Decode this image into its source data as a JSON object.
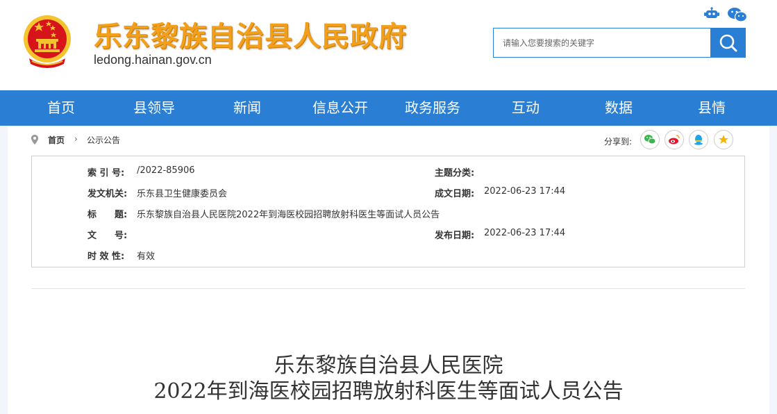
{
  "header": {
    "site_title": "乐东黎族自治县人民政府",
    "site_domain": "ledong.hainan.gov.cn",
    "robot_icon": "robot-icon",
    "wechat_icon": "wechat-icon",
    "search_placeholder": "请输入您要搜索的关键字",
    "search_icon": "search-icon"
  },
  "nav": {
    "items": [
      "首页",
      "县领导",
      "新闻",
      "信息公开",
      "政务服务",
      "互动",
      "数据",
      "县情"
    ]
  },
  "breadcrumb": {
    "home": "首页",
    "separator": "›",
    "current": "公示公告"
  },
  "share": {
    "label": "分享到:",
    "targets": [
      "wechat",
      "weibo",
      "qq",
      "favorite"
    ]
  },
  "meta": {
    "index_label": "索 引 号:",
    "index_value": "/2022-85906",
    "topic_label": "主题分类:",
    "topic_value": "",
    "issuer_label": "发文机关:",
    "issuer_value": "乐东县卫生健康委员会",
    "created_label": "成文日期:",
    "created_value": "2022-06-23 17:44",
    "title_label": "标　　题:",
    "title_value": "乐东黎族自治县人民医院2022年到海医校园招聘放射科医生等面试人员公告",
    "docno_label": "文　　号:",
    "docno_value": "",
    "published_label": "发布日期:",
    "published_value": "2022-06-23 17:44",
    "validity_label": "时 效 性:",
    "validity_value": "有效"
  },
  "article": {
    "title_line1": "乐东黎族自治县人民医院",
    "title_line2": "2022年到海医校园招聘放射科医生等面试人员公告"
  },
  "colors": {
    "brand_blue": "#2a7fd4",
    "title_orange": "#f2a01c",
    "emblem_red": "#d7141a",
    "emblem_gold": "#f4c430"
  }
}
